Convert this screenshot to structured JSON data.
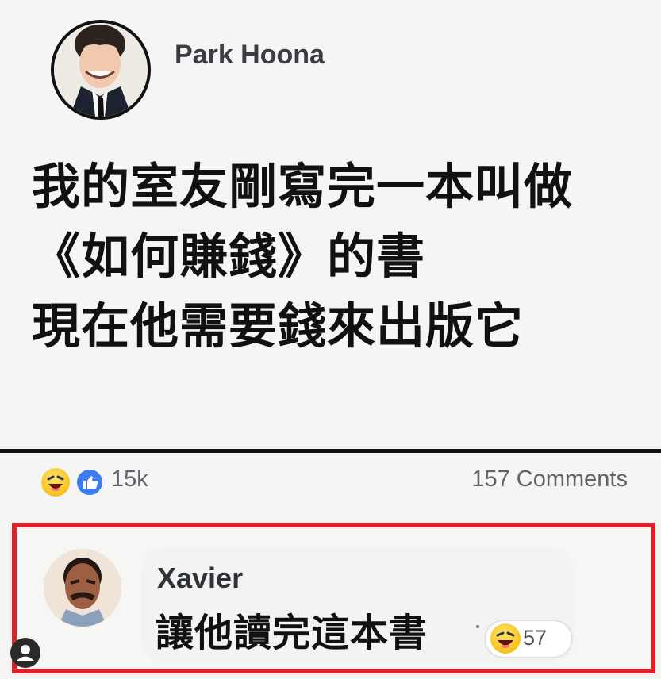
{
  "post": {
    "author": "Park Hoona",
    "lines": [
      "我的室友剛寫完一本叫做",
      "《如何賺錢》的書",
      "現在他需要錢來出版它"
    ]
  },
  "stats": {
    "reactions": "15k",
    "comments": "157 Comments",
    "icons": [
      "haha-icon",
      "like-icon"
    ],
    "like_color": "#3b7cf0"
  },
  "comment": {
    "author": "Xavier",
    "text": "讓他讀完這本書",
    "reaction_count": "57",
    "highlight_color": "#e01f28"
  },
  "icons": {
    "profile": "profile-icon"
  }
}
